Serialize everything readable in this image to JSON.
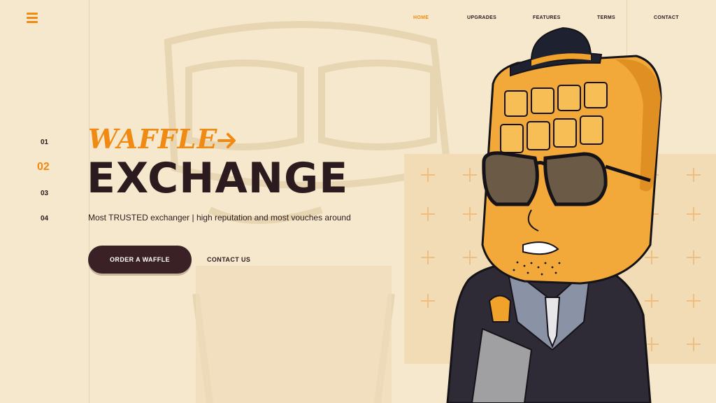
{
  "nav": {
    "items": [
      {
        "label": "HOME",
        "active": true
      },
      {
        "label": "UPGRADES",
        "active": false
      },
      {
        "label": "FEATURES",
        "active": false
      },
      {
        "label": "TERMS",
        "active": false
      },
      {
        "label": "CONTACT",
        "active": false
      }
    ]
  },
  "steps": [
    {
      "label": "01",
      "active": false
    },
    {
      "label": "02",
      "active": true
    },
    {
      "label": "03",
      "active": false
    },
    {
      "label": "04",
      "active": false
    }
  ],
  "hero": {
    "script_title": "WAFFLE",
    "title": "EXCHANGE",
    "tagline": "Most TRUSTED exchanger | high reputation and most vouches around"
  },
  "actions": {
    "order_label": "ORDER A WAFFLE",
    "contact_label": "CONTACT US"
  },
  "colors": {
    "background": "#f6e8cc",
    "accent": "#f08a12",
    "dark": "#2b1b1f"
  },
  "icons": {
    "menu": "hamburger-menu-icon",
    "arrow": "arrow-right-icon",
    "mascot": "waffle-mascot-illustration"
  }
}
